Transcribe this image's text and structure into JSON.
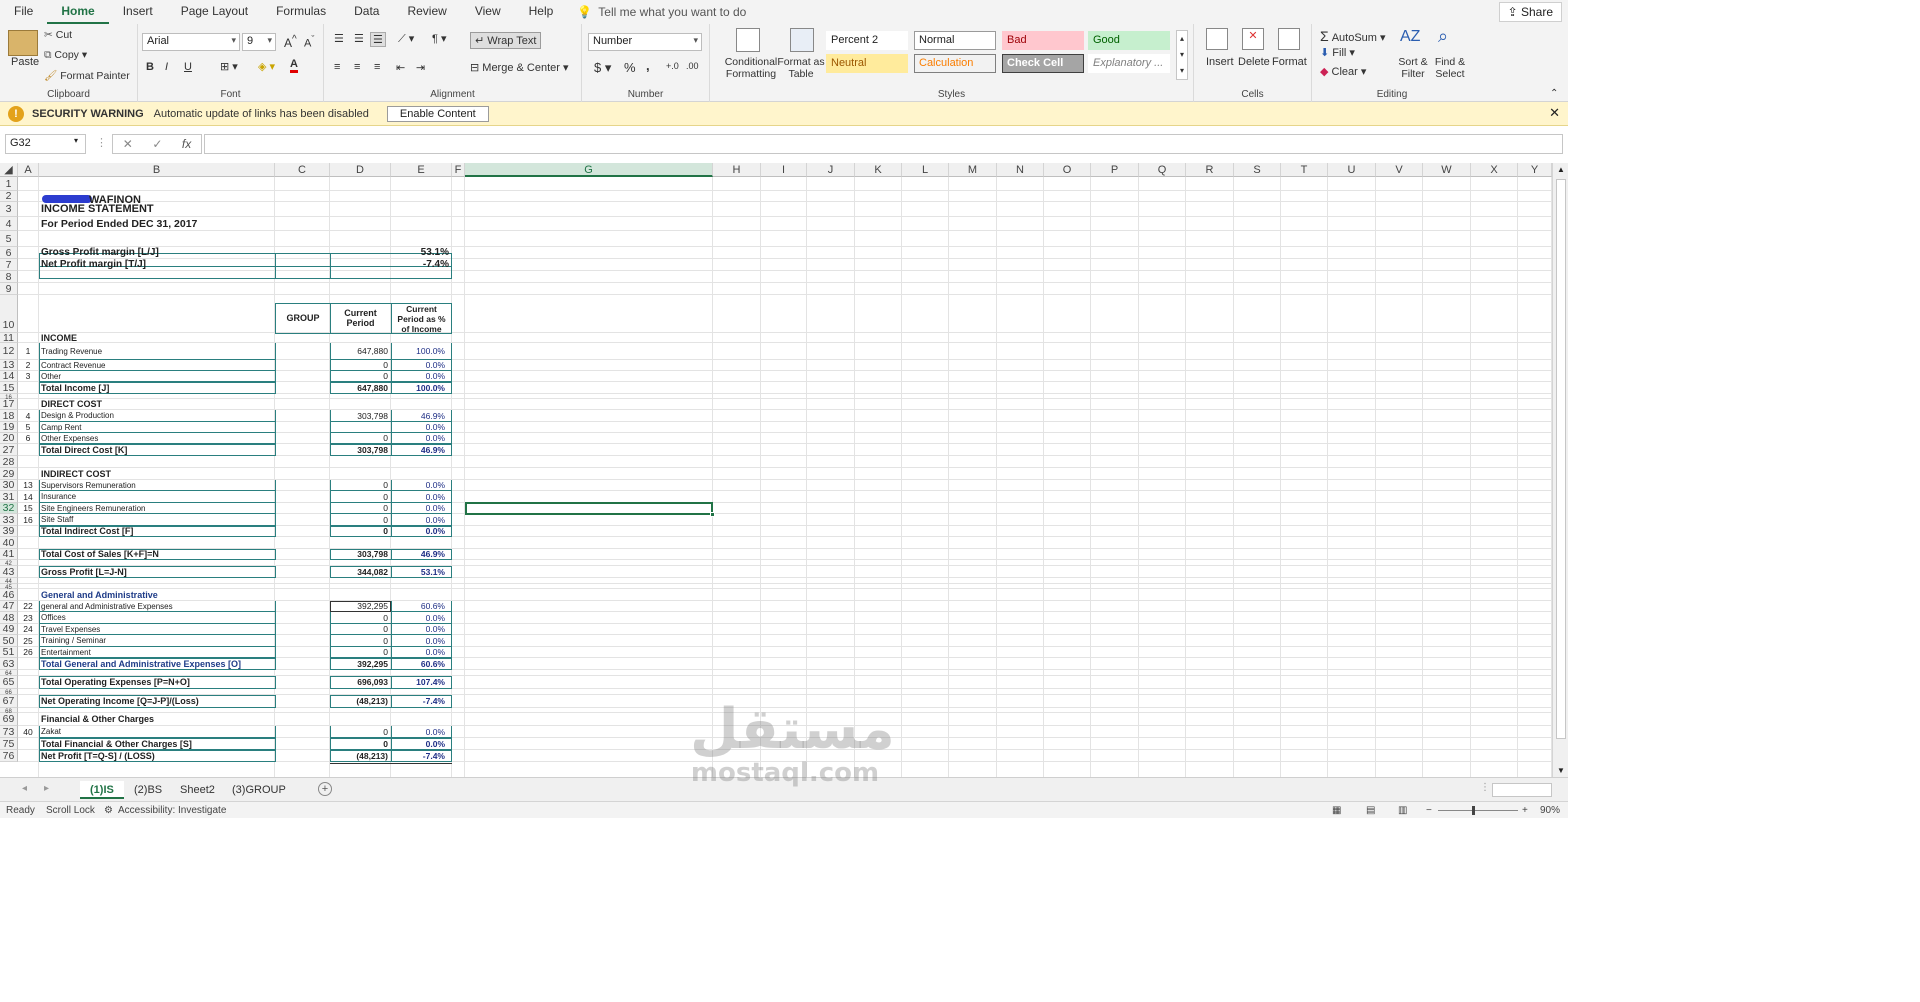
{
  "menu": {
    "tabs": [
      "File",
      "Home",
      "Insert",
      "Page Layout",
      "Formulas",
      "Data",
      "Review",
      "View",
      "Help"
    ],
    "active": "Home",
    "tell_me": "Tell me what you want to do",
    "share": "Share"
  },
  "ribbon": {
    "clipboard": {
      "label": "Clipboard",
      "paste": "Paste",
      "cut": "Cut",
      "copy": "Copy",
      "format_painter": "Format Painter"
    },
    "font": {
      "label": "Font",
      "name": "Arial",
      "size": "9",
      "bold": "B",
      "italic": "I",
      "underline": "U"
    },
    "alignment": {
      "label": "Alignment",
      "wrap_text": "Wrap Text",
      "merge_center": "Merge & Center"
    },
    "number": {
      "label": "Number",
      "format": "Number",
      "currency": "$",
      "percent": "%",
      "comma": ","
    },
    "styles": {
      "label": "Styles",
      "conditional_formatting": "Conditional Formatting",
      "format_as_table": "Format as Table",
      "cells": [
        {
          "name": "Percent 2",
          "bg": "#ffffff",
          "fg": "#222222",
          "border": "#ffffff"
        },
        {
          "name": "Normal",
          "bg": "#ffffff",
          "fg": "#222222",
          "border": "#9a9a9a"
        },
        {
          "name": "Bad",
          "bg": "#ffc7ce",
          "fg": "#9c0006",
          "border": "#ffc7ce"
        },
        {
          "name": "Good",
          "bg": "#c6efce",
          "fg": "#006100",
          "border": "#c6efce"
        },
        {
          "name": "Neutral",
          "bg": "#ffeb9c",
          "fg": "#9c5700",
          "border": "#ffeb9c"
        },
        {
          "name": "Calculation",
          "bg": "#f2f2f2",
          "fg": "#fa7d00",
          "border": "#7f7f7f"
        },
        {
          "name": "Check Cell",
          "bg": "#a5a5a5",
          "fg": "#ffffff",
          "border": "#3f3f3f"
        },
        {
          "name": "Explanatory ...",
          "bg": "#ffffff",
          "fg": "#7f7f7f",
          "border": "#ffffff"
        }
      ]
    },
    "cells": {
      "label": "Cells",
      "insert": "Insert",
      "delete": "Delete",
      "format": "Format"
    },
    "editing": {
      "label": "Editing",
      "autosum": "AutoSum",
      "fill": "Fill",
      "clear": "Clear",
      "sort_filter": "Sort & Filter",
      "find_select": "Find & Select"
    }
  },
  "security": {
    "title": "SECURITY WARNING",
    "message": "Automatic update of links has been disabled",
    "button": "Enable Content"
  },
  "formula_bar": {
    "name_box": "G32",
    "fx": "fx",
    "value": ""
  },
  "columns": [
    "A",
    "B",
    "C",
    "D",
    "E",
    "F",
    "G",
    "H",
    "I",
    "J",
    "K",
    "L",
    "M",
    "N",
    "O",
    "P",
    "Q",
    "R",
    "S",
    "T",
    "U",
    "V",
    "W",
    "X",
    "Y"
  ],
  "selected_column": "G",
  "selected_row": "32",
  "rows": [
    "1",
    "2",
    "3",
    "4",
    "5",
    "6",
    "7",
    "8",
    "9",
    "10",
    "11",
    "12",
    "13",
    "14",
    "15",
    "16",
    "17",
    "18",
    "19",
    "20",
    "27",
    "28",
    "29",
    "30",
    "31",
    "32",
    "33",
    "39",
    "40",
    "41",
    "42",
    "43",
    "44",
    "45",
    "46",
    "47",
    "48",
    "49",
    "50",
    "51",
    "63",
    "64",
    "65",
    "66",
    "67",
    "68",
    "69",
    "73",
    "75",
    "76"
  ],
  "sheet": {
    "company": "WAFINON",
    "title": "INCOME STATEMENT",
    "period": "For Period Ended DEC 31, 2017",
    "gross_margin_label": "Gross Profit margin  [L/J]",
    "gross_margin_value": "53.1%",
    "net_margin_label": "Net Profit margin  [T/J]",
    "net_margin_value": "-7.4%",
    "hdr_group": "GROUP",
    "hdr_current": "Current Period",
    "hdr_pct": "Current Period as % of Income",
    "lines": [
      {
        "row": "11",
        "a": "",
        "b": "INCOME",
        "d": "",
        "e": "",
        "style": "section"
      },
      {
        "row": "12",
        "a": "1",
        "b": "Trading Revenue",
        "d": "647,880",
        "e": "100.0%",
        "style": "item"
      },
      {
        "row": "13",
        "a": "2",
        "b": "Contract Revenue",
        "d": "0",
        "e": "0.0%",
        "style": "item"
      },
      {
        "row": "14",
        "a": "3",
        "b": "Other",
        "d": "0",
        "e": "0.0%",
        "style": "item"
      },
      {
        "row": "15",
        "a": "",
        "b": "Total Income  [J]",
        "d": "647,880",
        "e": "100.0%",
        "style": "total"
      },
      {
        "row": "17",
        "a": "",
        "b": "DIRECT COST",
        "d": "",
        "e": "",
        "style": "section"
      },
      {
        "row": "18",
        "a": "4",
        "b": "Design & Production",
        "d": "303,798",
        "e": "46.9%",
        "style": "item"
      },
      {
        "row": "19",
        "a": "5",
        "b": "Camp Rent",
        "d": "",
        "e": "0.0%",
        "style": "item"
      },
      {
        "row": "20",
        "a": "6",
        "b": "Other Expenses",
        "d": "0",
        "e": "0.0%",
        "style": "item"
      },
      {
        "row": "27",
        "a": "",
        "b": "Total Direct Cost  [K]",
        "d": "303,798",
        "e": "46.9%",
        "style": "total"
      },
      {
        "row": "29",
        "a": "",
        "b": "INDIRECT COST",
        "d": "",
        "e": "",
        "style": "section"
      },
      {
        "row": "30",
        "a": "13",
        "b": "Supervisors Remuneration",
        "d": "0",
        "e": "0.0%",
        "style": "item"
      },
      {
        "row": "31",
        "a": "14",
        "b": "Insurance",
        "d": "0",
        "e": "0.0%",
        "style": "item"
      },
      {
        "row": "32",
        "a": "15",
        "b": "Site Engineers Remuneration",
        "d": "0",
        "e": "0.0%",
        "style": "item"
      },
      {
        "row": "33",
        "a": "16",
        "b": "Site Staff",
        "d": "0",
        "e": "0.0%",
        "style": "item"
      },
      {
        "row": "39",
        "a": "",
        "b": "Total Indirect Cost  [F]",
        "d": "0",
        "e": "0.0%",
        "style": "total"
      },
      {
        "row": "41",
        "a": "",
        "b": "Total Cost of Sales  [K+F]=N",
        "d": "303,798",
        "e": "46.9%",
        "style": "total"
      },
      {
        "row": "43",
        "a": "",
        "b": "Gross Profit  [L=J-N]",
        "d": "344,082",
        "e": "53.1%",
        "style": "total"
      },
      {
        "row": "46",
        "a": "",
        "b": "General and Administrative",
        "d": "",
        "e": "",
        "style": "section-navy"
      },
      {
        "row": "47",
        "a": "22",
        "b": "general and Administrative Expenses",
        "d": "392,295",
        "e": "60.6%",
        "style": "item"
      },
      {
        "row": "48",
        "a": "23",
        "b": "Offices",
        "d": "0",
        "e": "0.0%",
        "style": "item"
      },
      {
        "row": "49",
        "a": "24",
        "b": "Travel Expenses",
        "d": "0",
        "e": "0.0%",
        "style": "item"
      },
      {
        "row": "50",
        "a": "25",
        "b": "Training / Seminar",
        "d": "0",
        "e": "0.0%",
        "style": "item"
      },
      {
        "row": "51",
        "a": "26",
        "b": "Entertainment",
        "d": "0",
        "e": "0.0%",
        "style": "item"
      },
      {
        "row": "63",
        "a": "",
        "b": "Total General and Administrative Expenses  [O]",
        "d": "392,295",
        "e": "60.6%",
        "style": "total-navy"
      },
      {
        "row": "65",
        "a": "",
        "b": "Total Operating Expenses  [P=N+O]",
        "d": "696,093",
        "e": "107.4%",
        "style": "total"
      },
      {
        "row": "67",
        "a": "",
        "b": "Net Operating Income   [Q=J-P]/(Loss)",
        "d": "(48,213)",
        "e": "-7.4%",
        "style": "total"
      },
      {
        "row": "69",
        "a": "",
        "b": "Financial  & Other Charges",
        "d": "",
        "e": "",
        "style": "section"
      },
      {
        "row": "73",
        "a": "40",
        "b": "Zakat",
        "d": "0",
        "e": "0.0%",
        "style": "item"
      },
      {
        "row": "75",
        "a": "",
        "b": "Total Financial  & Other Charges  [S]",
        "d": "0",
        "e": "0.0%",
        "style": "total"
      },
      {
        "row": "76",
        "a": "",
        "b": "Net Profit  [T=Q-S] / (LOSS)",
        "d": "(48,213)",
        "e": "-7.4%",
        "style": "total"
      }
    ]
  },
  "sheet_tabs": [
    "(1)IS",
    "(2)BS",
    "Sheet2",
    "(3)GROUP"
  ],
  "active_sheet": "(1)IS",
  "status": {
    "ready": "Ready",
    "scroll_lock": "Scroll Lock",
    "accessibility": "Accessibility: Investigate",
    "zoom": "90%"
  },
  "watermark": {
    "arabic": "مستقل",
    "latin": "mostaql.com"
  }
}
